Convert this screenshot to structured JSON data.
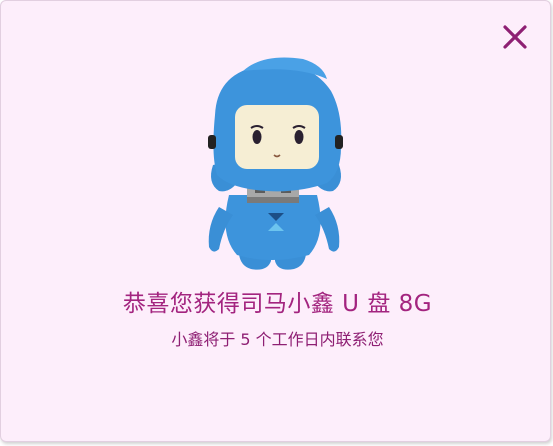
{
  "dialog": {
    "title": "恭喜您获得司马小鑫 U 盘 8G",
    "subtitle": "小鑫将于 5 个工作日内联系您",
    "close_icon": "close-icon",
    "mascot_image": "usb-mascot-image"
  },
  "colors": {
    "background": "#fdeefb",
    "title_text": "#a3247f",
    "subtitle_text": "#8e1f73",
    "close_icon": "#8e1f73",
    "mascot_blue": "#3d94dc",
    "mascot_face": "#f6eed4"
  }
}
